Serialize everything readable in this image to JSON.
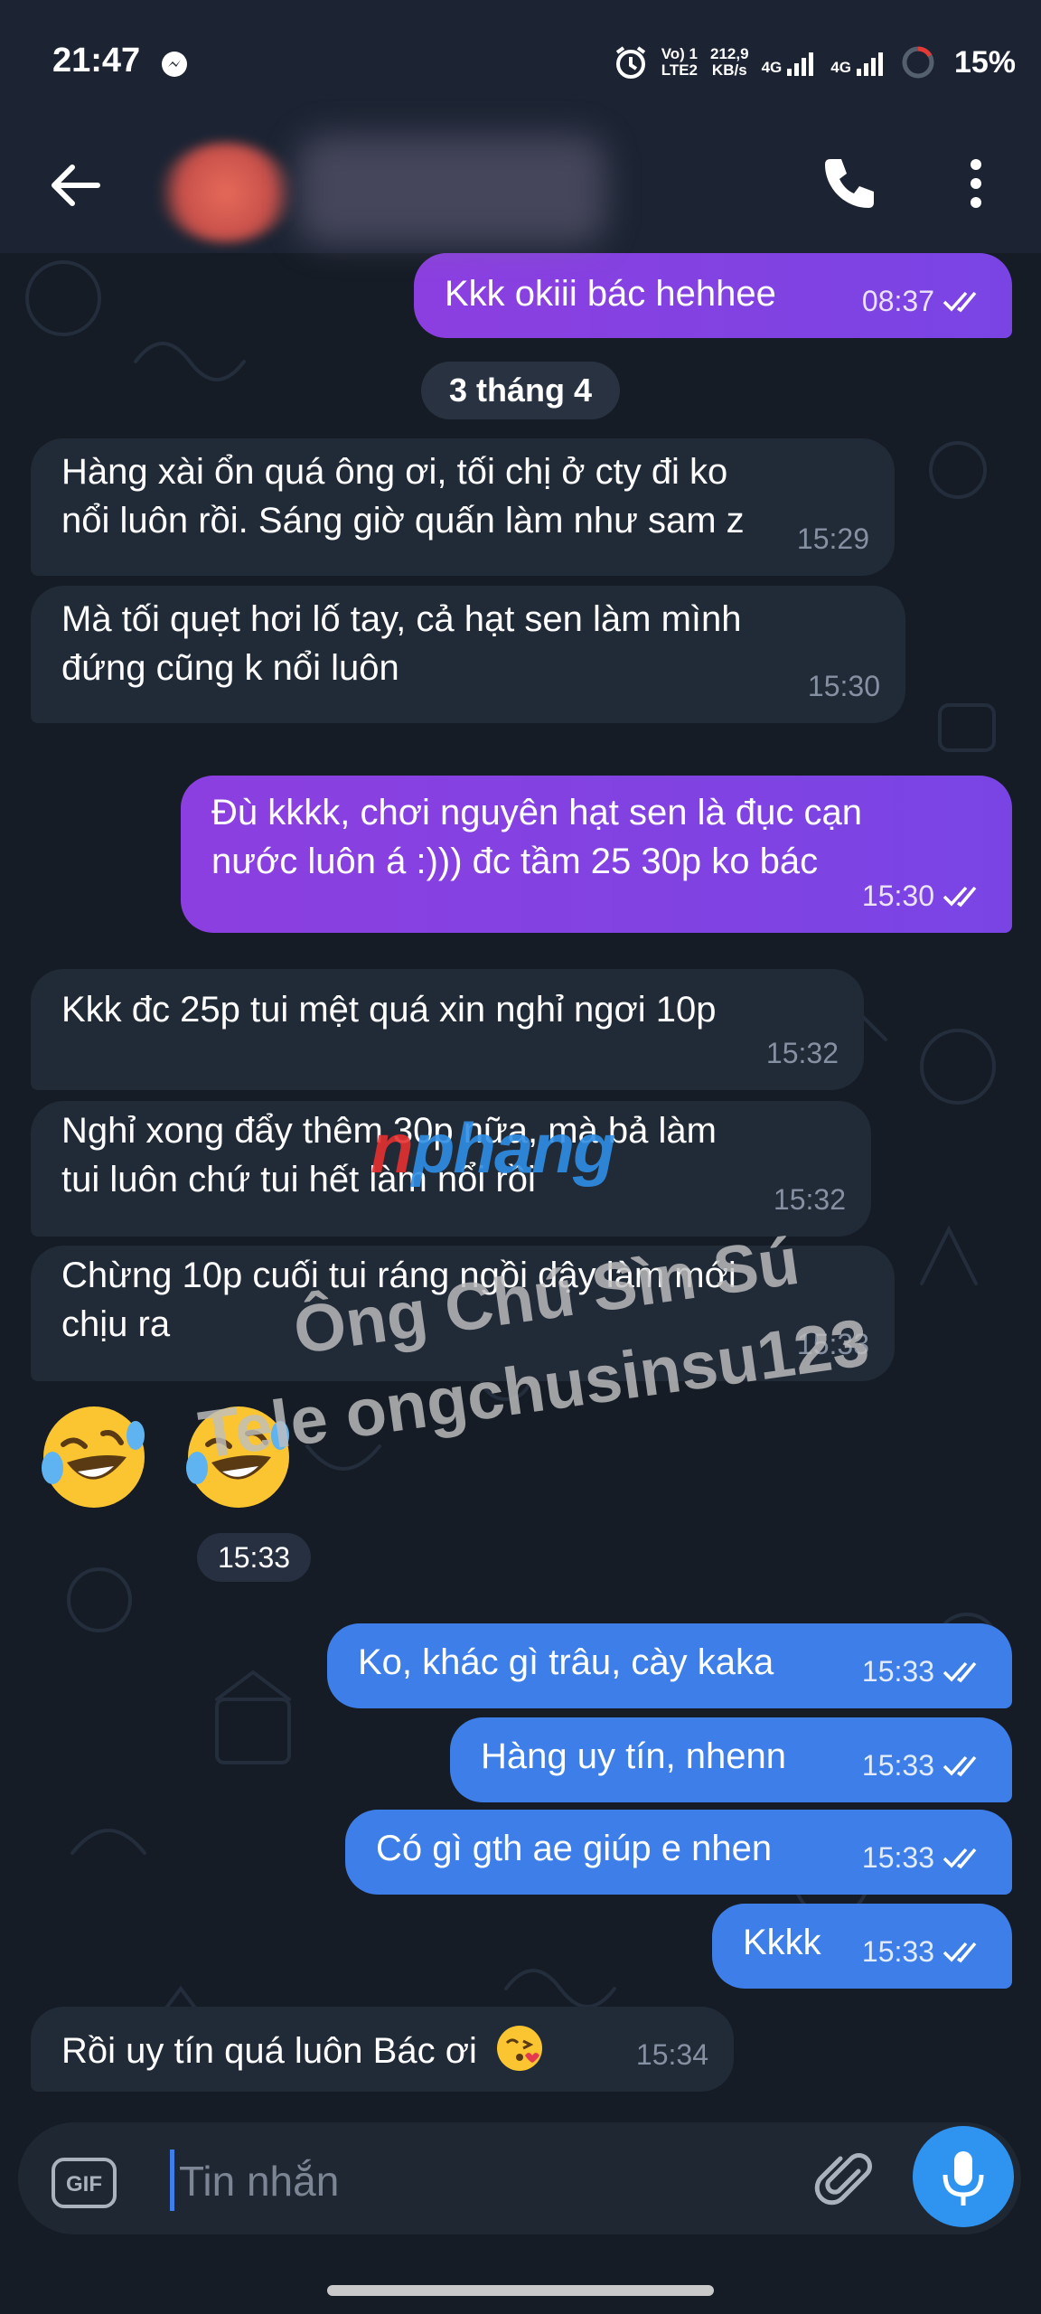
{
  "status_bar": {
    "time": "21:47",
    "net_line1": "Vo) 1",
    "net_line2": "LTE2",
    "speed_value": "212,9",
    "speed_unit": "KB/s",
    "sim1_type": "4G",
    "sim2_type": "4G",
    "battery": "15%"
  },
  "header": {
    "back_icon": "arrow-left-icon",
    "call_icon": "phone-icon",
    "more_icon": "more-vertical-icon"
  },
  "messages": [
    {
      "text": "Kkk okiii bác hehhee",
      "time": "08:37",
      "direction": "out",
      "color": "#8c3fe0",
      "read": true
    },
    {
      "date_separator": "3 tháng 4"
    },
    {
      "text_lines": [
        "Hàng xài ổn quá ông ơi, tối chị ở cty đi ko",
        "nổi luôn rồi. Sáng giờ quấn làm như sam z"
      ],
      "time": "15:29",
      "direction": "in"
    },
    {
      "text_lines": [
        "Mà tối quẹt hơi lố tay, cả hạt sen làm mình",
        "đứng cũng k nổi luôn"
      ],
      "time": "15:30",
      "direction": "in"
    },
    {
      "text_lines": [
        "Đù kkkk, chơi nguyên hạt sen là đục cạn",
        "nước luôn á :))) đc tầm 25 30p ko bác"
      ],
      "time": "15:30",
      "direction": "out",
      "color": "#8c3fe0",
      "read": true
    },
    {
      "text": "Kkk đc 25p tui mệt quá xin nghỉ ngơi 10p",
      "time": "15:32",
      "direction": "in"
    },
    {
      "text_lines": [
        "Nghỉ xong đẩy thêm 30p nữa, mà bả làm",
        "tui luôn chứ tui hết làm nổi rồi"
      ],
      "time": "15:32",
      "direction": "in"
    },
    {
      "text_lines": [
        "Chừng 10p cuối tui ráng ngồi dậy làm mới",
        "chịu ra"
      ],
      "time": "15:33",
      "direction": "in"
    },
    {
      "emoji_names": [
        "rolling-on-floor-laughing-emoji",
        "rolling-on-floor-laughing-emoji"
      ],
      "time": "15:33",
      "direction": "in"
    },
    {
      "text": "Ko, khác gì trâu, cày kaka",
      "time": "15:33",
      "direction": "out",
      "color": "#3e7ee8",
      "read": true
    },
    {
      "text": "Hàng uy tín, nhenn",
      "time": "15:33",
      "direction": "out",
      "color": "#3e7ee8",
      "read": true
    },
    {
      "text": "Có gì gth ae giúp e nhen",
      "time": "15:33",
      "direction": "out",
      "color": "#3e7ee8",
      "read": true
    },
    {
      "text": "Kkkk",
      "time": "15:33",
      "direction": "out",
      "color": "#3e7ee8",
      "read": true
    },
    {
      "text": "Rồi uy tín quá luôn Bác ơi",
      "emoji_name": "face-blowing-kiss-emoji",
      "time": "15:34",
      "direction": "in"
    }
  ],
  "watermarks": {
    "logo_part1": "n",
    "logo_part2": "phang",
    "line1": "Ông Chú Sìn Sú",
    "line2": "Tele ongchusinsu123"
  },
  "composer": {
    "gif_label": "GIF",
    "placeholder": "Tin nhắn",
    "attach_icon": "paperclip-icon",
    "mic_icon": "microphone-icon"
  }
}
